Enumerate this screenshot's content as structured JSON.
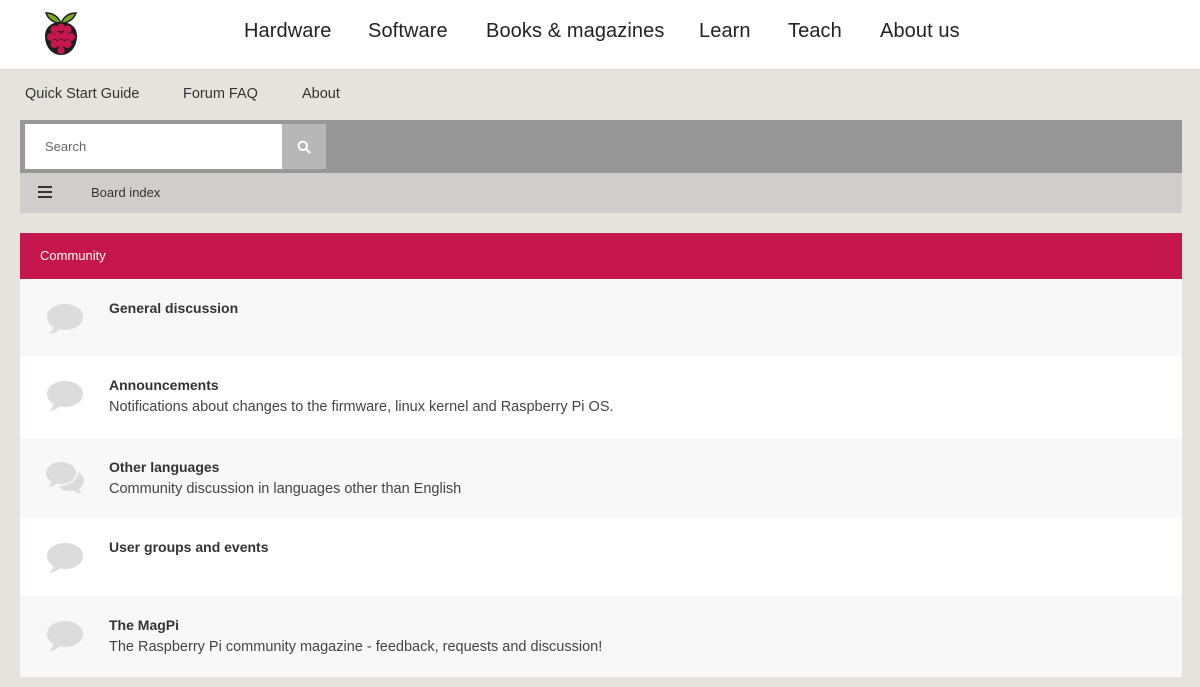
{
  "brand": {
    "logo_icon": "raspberry-logo-icon",
    "colors": {
      "accent": "#c5174d",
      "leaf": "#75a928"
    }
  },
  "main_nav": [
    {
      "label": "Hardware"
    },
    {
      "label": "Software"
    },
    {
      "label": "Books & magazines"
    },
    {
      "label": "Learn"
    },
    {
      "label": "Teach"
    },
    {
      "label": "About us"
    }
  ],
  "sub_nav": [
    {
      "label": "Quick Start Guide"
    },
    {
      "label": "Forum FAQ"
    },
    {
      "label": "About"
    }
  ],
  "search": {
    "placeholder": "Search",
    "button_icon": "search-icon"
  },
  "breadcrumb": {
    "menu_icon": "hamburger-menu-icon",
    "label": "Board index"
  },
  "category": {
    "title": "Community"
  },
  "forums": [
    {
      "title": "General discussion",
      "description": "",
      "icon": "chat-bubble-icon"
    },
    {
      "title": "Announcements",
      "description": "Notifications about changes to the firmware, linux kernel and Raspberry Pi OS.",
      "icon": "chat-bubble-icon"
    },
    {
      "title": "Other languages",
      "description": "Community discussion in languages other than English",
      "icon": "chat-bubbles-icon"
    },
    {
      "title": "User groups and events",
      "description": "",
      "icon": "chat-bubble-icon"
    },
    {
      "title": "The MagPi",
      "description": "The Raspberry Pi community magazine - feedback, requests and discussion!",
      "icon": "chat-bubble-icon"
    }
  ]
}
